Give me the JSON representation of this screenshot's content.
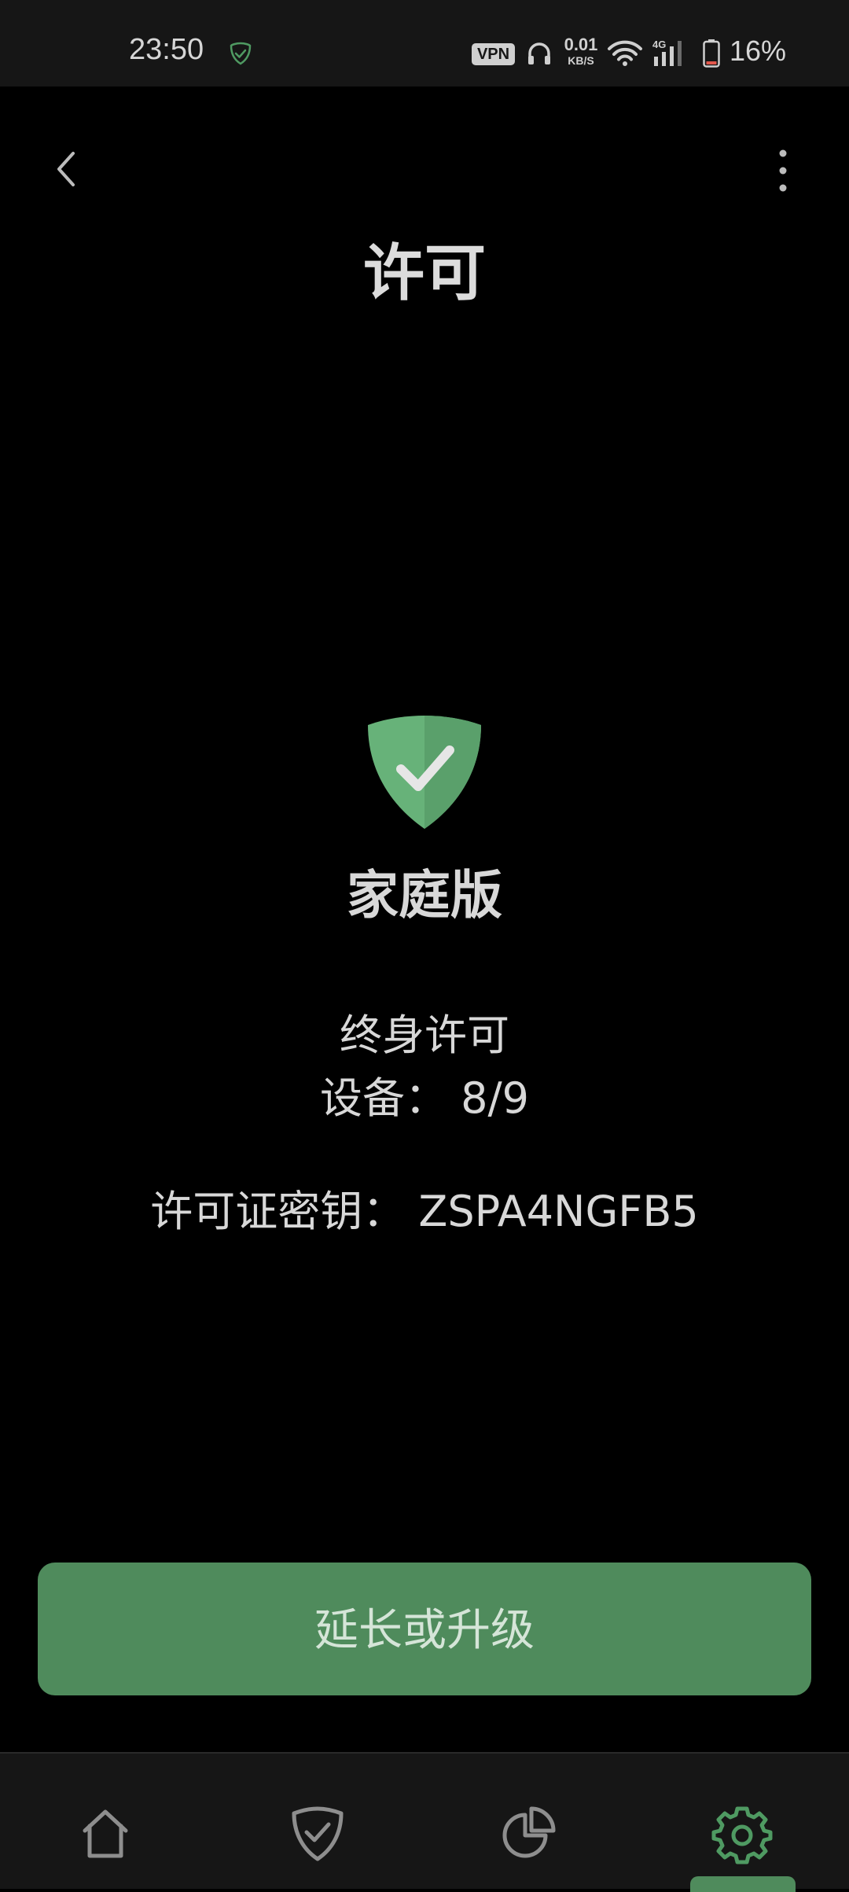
{
  "status_bar": {
    "time": "23:50",
    "vpn_label": "VPN",
    "net_speed_value": "0.01",
    "net_speed_unit": "KB/S",
    "signal_label": "4G",
    "battery_percent": "16%"
  },
  "header": {
    "title": "许可"
  },
  "license": {
    "edition": "家庭版",
    "type": "终身许可",
    "devices": "设备：  8/9",
    "key": "许可证密钥：  ZSPA4NGFB5"
  },
  "actions": {
    "extend_label": "延长或升级"
  },
  "bottom_nav": {
    "items": [
      {
        "icon": "home-icon"
      },
      {
        "icon": "shield-check-icon"
      },
      {
        "icon": "pie-chart-icon"
      },
      {
        "icon": "gear-icon"
      }
    ],
    "active_index": 3
  },
  "colors": {
    "accent": "#4f8b5c",
    "shield_light": "#67b279",
    "shield_dark": "#5aa06b",
    "background": "#000000",
    "bars": "#161616"
  }
}
